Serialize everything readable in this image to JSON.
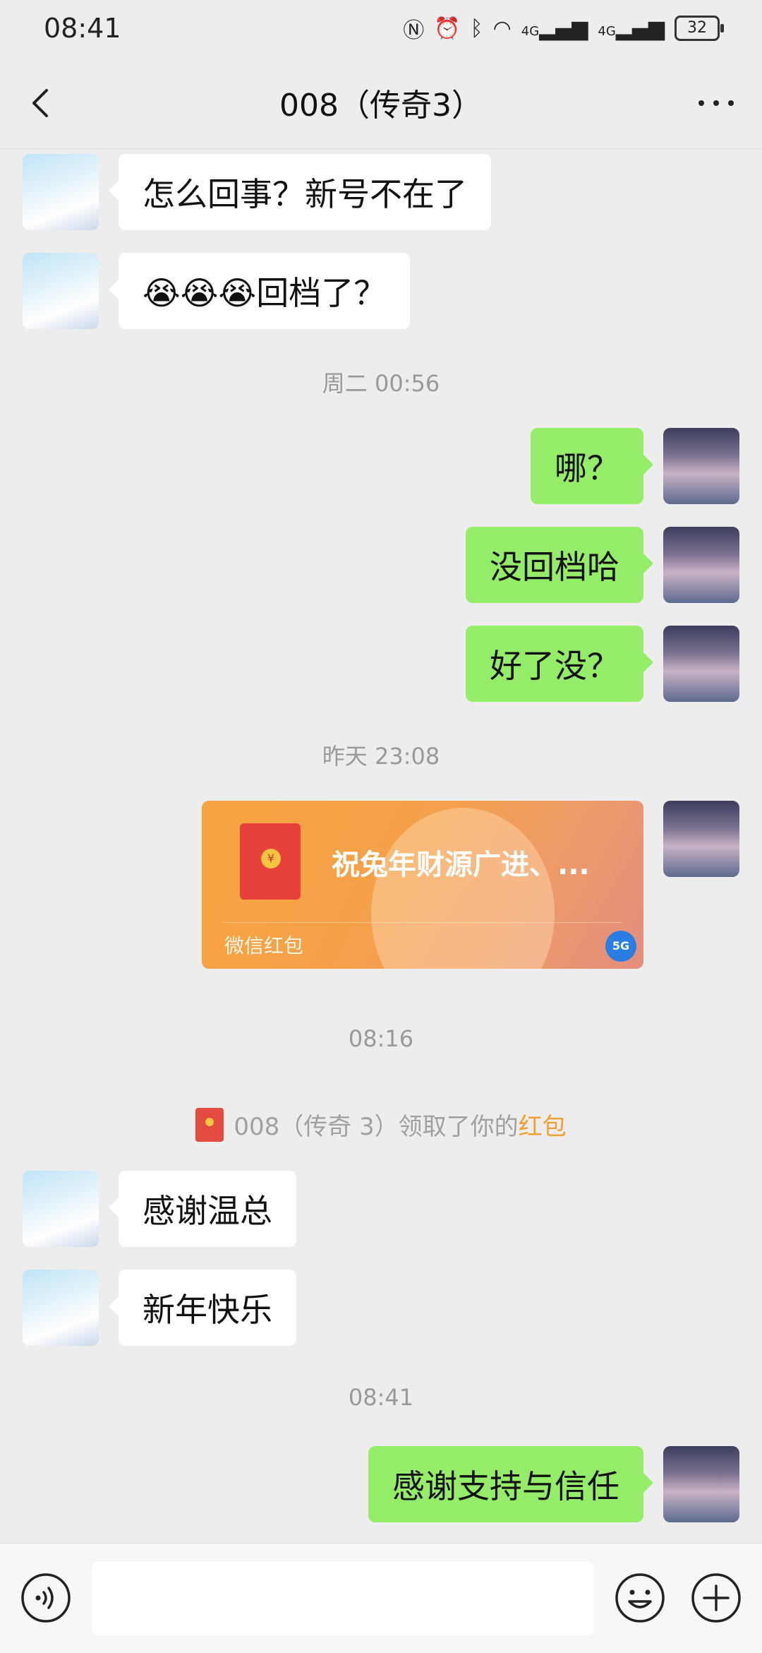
{
  "status_bar": {
    "time": "08:41",
    "signal1": "4G",
    "signal2": "4G",
    "battery": "32"
  },
  "header": {
    "title": "008（传奇3）"
  },
  "messages": [
    {
      "from": "friend",
      "text": "怎么回事？新号不在了"
    },
    {
      "from": "friend",
      "text": "😭😭😭回档了？"
    },
    {
      "type": "timestamp",
      "text": "周二 00:56"
    },
    {
      "from": "me",
      "text": "哪？"
    },
    {
      "from": "me",
      "text": "没回档哈"
    },
    {
      "from": "me",
      "text": "好了没？"
    },
    {
      "type": "timestamp",
      "text": "昨天 23:08"
    },
    {
      "from": "me",
      "type": "red_packet",
      "text": "祝兔年财源广进、...",
      "label": "微信红包",
      "badge": "5G"
    },
    {
      "type": "timestamp",
      "text": "08:16"
    },
    {
      "type": "system",
      "text": "008（传奇 3）领取了你的",
      "highlight": "红包"
    },
    {
      "from": "friend",
      "text": "感谢温总"
    },
    {
      "from": "friend",
      "text": "新年快乐"
    },
    {
      "type": "timestamp",
      "text": "08:41"
    },
    {
      "from": "me",
      "text": "感谢支持与信任"
    }
  ],
  "input_bar": {
    "voice_icon": "voice-icon",
    "emoji_icon": "emoji-icon",
    "plus_icon": "plus-icon",
    "value": ""
  }
}
